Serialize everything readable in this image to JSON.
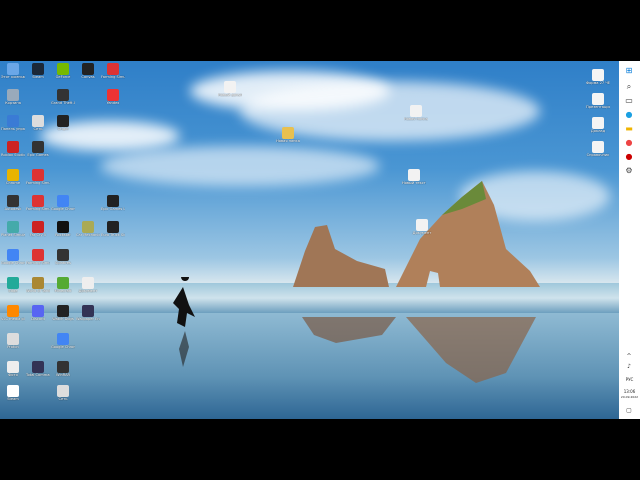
{
  "desktop": {
    "icons": [
      {
        "name": "icon-1",
        "label": "Этот компьютер",
        "color": "#6aa7e8"
      },
      {
        "name": "icon-2",
        "label": "Steam",
        "color": "#1b2838"
      },
      {
        "name": "icon-3",
        "label": "GeForce",
        "color": "#76b900"
      },
      {
        "name": "icon-4",
        "label": "Canvas",
        "color": "#222"
      },
      {
        "name": "icon-5",
        "label": "Farming Simulator",
        "color": "#d33"
      },
      {
        "name": "icon-6",
        "label": "Корзина",
        "color": "#9ab"
      },
      {
        "name": "icon-7",
        "label": "Grand Theft Auto",
        "color": "#333"
      },
      {
        "name": "icon-8",
        "label": "Yandex",
        "color": "#e33"
      },
      {
        "name": "icon-9",
        "label": "Панель управления",
        "color": "#3a7bd5"
      },
      {
        "name": "icon-10",
        "label": "Сеть",
        "color": "#ddd"
      },
      {
        "name": "icon-11",
        "label": "Origin",
        "color": "#222"
      },
      {
        "name": "icon-12",
        "label": "Roblox Studio",
        "color": "#c22"
      },
      {
        "name": "icon-13",
        "label": "Epic Games",
        "color": "#333"
      },
      {
        "name": "icon-14",
        "label": "Chrome",
        "color": "#e8b400"
      },
      {
        "name": "icon-15",
        "label": "Farming Simulator 19",
        "color": "#d33"
      },
      {
        "name": "icon-16",
        "label": "Autodesk",
        "color": "#333"
      },
      {
        "name": "icon-17",
        "label": "Farming Simulator 17",
        "color": "#d33"
      },
      {
        "name": "icon-18",
        "label": "Google Chrome",
        "color": "#4285f4"
      },
      {
        "name": "icon-19",
        "label": "Epic Games Launcher",
        "color": "#222"
      },
      {
        "name": "icon-20",
        "label": "Planet Simulator",
        "color": "#4aa"
      },
      {
        "name": "icon-21",
        "label": "Far Cry 5",
        "color": "#c22"
      },
      {
        "name": "icon-22",
        "label": "Rockstar",
        "color": "#111"
      },
      {
        "name": "icon-23",
        "label": "Car Mechanic",
        "color": "#aa5"
      },
      {
        "name": "icon-24",
        "label": "Euro Truck Simulator",
        "color": "#222"
      },
      {
        "name": "icon-25",
        "label": "Google Chrome",
        "color": "#4285f4"
      },
      {
        "name": "icon-26",
        "label": "Farming Simulator",
        "color": "#d33"
      },
      {
        "name": "icon-27",
        "label": "Spintires",
        "color": "#333"
      },
      {
        "name": "icon-28",
        "label": "Edge",
        "color": "#2a9"
      },
      {
        "name": "icon-29",
        "label": "World of Tanks",
        "color": "#a83"
      },
      {
        "name": "icon-30",
        "label": "Minecraft",
        "color": "#5a3"
      },
      {
        "name": "icon-31",
        "label": "Документ",
        "color": "#eee"
      },
      {
        "name": "icon-32",
        "label": "VLC media player",
        "color": "#f80"
      },
      {
        "name": "icon-33",
        "label": "Discord",
        "color": "#5865f2"
      },
      {
        "name": "icon-34",
        "label": "Watch Dogs",
        "color": "#222"
      },
      {
        "name": "icon-35",
        "label": "Wallpaper Engine",
        "color": "#335"
      },
      {
        "name": "icon-36",
        "label": "Proton",
        "color": "#ddd"
      },
      {
        "name": "icon-37",
        "label": "Google Chrome",
        "color": "#4285f4"
      },
      {
        "name": "icon-38",
        "label": "Фото",
        "color": "#eee"
      },
      {
        "name": "icon-39",
        "label": "Total Commander",
        "color": "#335"
      },
      {
        "name": "icon-40",
        "label": "WinRAR",
        "color": "#333"
      },
      {
        "name": "icon-41",
        "label": "Steam",
        "color": "#fff"
      },
      {
        "name": "icon-42",
        "label": "Сеть",
        "color": "#ddd"
      }
    ],
    "files": [
      {
        "name": "file-1",
        "label": "Новый документ"
      },
      {
        "name": "file-2",
        "label": "Новая папка"
      },
      {
        "name": "file-3",
        "label": "Новая папка (2)"
      },
      {
        "name": "file-4",
        "label": "Новый текстовый документ"
      },
      {
        "name": "file-5",
        "label": "Документ"
      }
    ],
    "right_files": [
      {
        "name": "rfile-1",
        "label": "Форма 27 ЧЕТВ"
      },
      {
        "name": "rfile-2",
        "label": "Презентация"
      },
      {
        "name": "rfile-3",
        "label": "Доклад"
      },
      {
        "name": "rfile-4",
        "label": "Справочник"
      }
    ]
  },
  "taskbar": {
    "lang": "РУС",
    "time": "13:06",
    "date": "20.09.2022"
  }
}
